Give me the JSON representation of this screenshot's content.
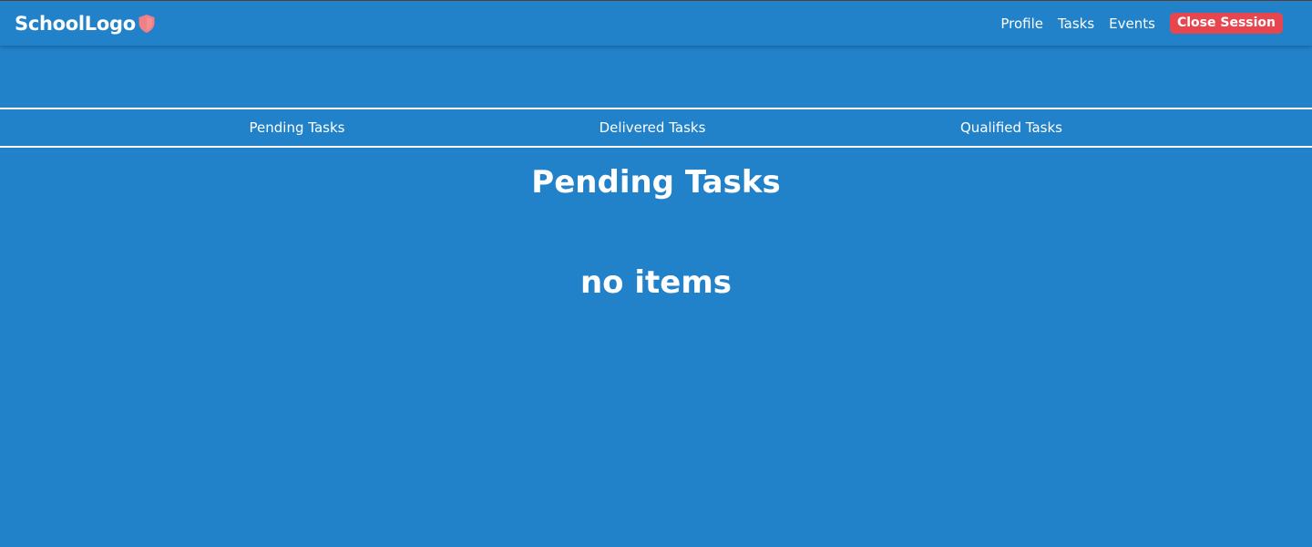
{
  "navbar": {
    "brand": "SchoolLogo",
    "brand_icon": "shield-icon",
    "links": [
      "Profile",
      "Tasks",
      "Events"
    ],
    "close_label": "Close Session"
  },
  "tabs": [
    "Pending Tasks",
    "Delivered Tasks",
    "Qualified Tasks"
  ],
  "main": {
    "title": "Pending Tasks",
    "empty_message": "no items"
  },
  "colors": {
    "background": "#2181c9",
    "close_button": "#e8464f",
    "shield": "#f07f87",
    "text": "#ffffff"
  }
}
